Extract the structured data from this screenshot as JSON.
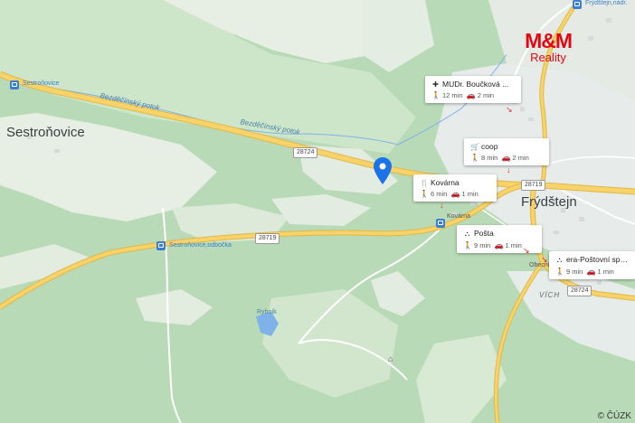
{
  "brand": {
    "name": "M&M",
    "subtitle": "Reality",
    "color": "#e30613"
  },
  "copyright": "© ČÚZK",
  "places": {
    "sestronovice": "Sestroňovice",
    "frydstejn": "Frýdštejn",
    "vich": "VÍCH",
    "kovarna_small": "Kovárna",
    "sestradovice_stop": "Sestroňovice",
    "sestronovice_odbocka": "Sestroňovice,odbočka",
    "rybnik": "Rybník",
    "obecni": "Obecní ú...",
    "frydstejn_top": "Frýdštejn,nádr."
  },
  "streams": {
    "s1": "Bezděčínský potok",
    "s2": "Bezděčínský potok"
  },
  "roads": {
    "r1": "28724",
    "r2": "28719",
    "r3": "28719",
    "r4": "28724"
  },
  "poi": [
    {
      "icon": "medical-icon",
      "glyph": "✚",
      "name": "MUDr. Boučková ...",
      "walk": "12 min",
      "car": "2 min"
    },
    {
      "icon": "cart-icon",
      "glyph": "🛒",
      "name": "coop",
      "walk": "8 min",
      "car": "2 min"
    },
    {
      "icon": "restaurant-icon",
      "glyph": "🍴",
      "name": "Kovárna",
      "walk": "6 min",
      "car": "1 min"
    },
    {
      "icon": "post-icon",
      "glyph": "⛫",
      "name": "Pošta",
      "walk": "9 min",
      "car": "1 min"
    },
    {
      "icon": "bank-icon",
      "glyph": "⛫",
      "name": "era-Poštovní spoř...",
      "walk": "9 min",
      "car": "1 min"
    }
  ],
  "colors": {
    "forest": "#b7d9b4",
    "meadow": "#e9efe6",
    "road": "#f6cf5f",
    "water": "#7fb2e8",
    "pin": "#1a73e8"
  }
}
